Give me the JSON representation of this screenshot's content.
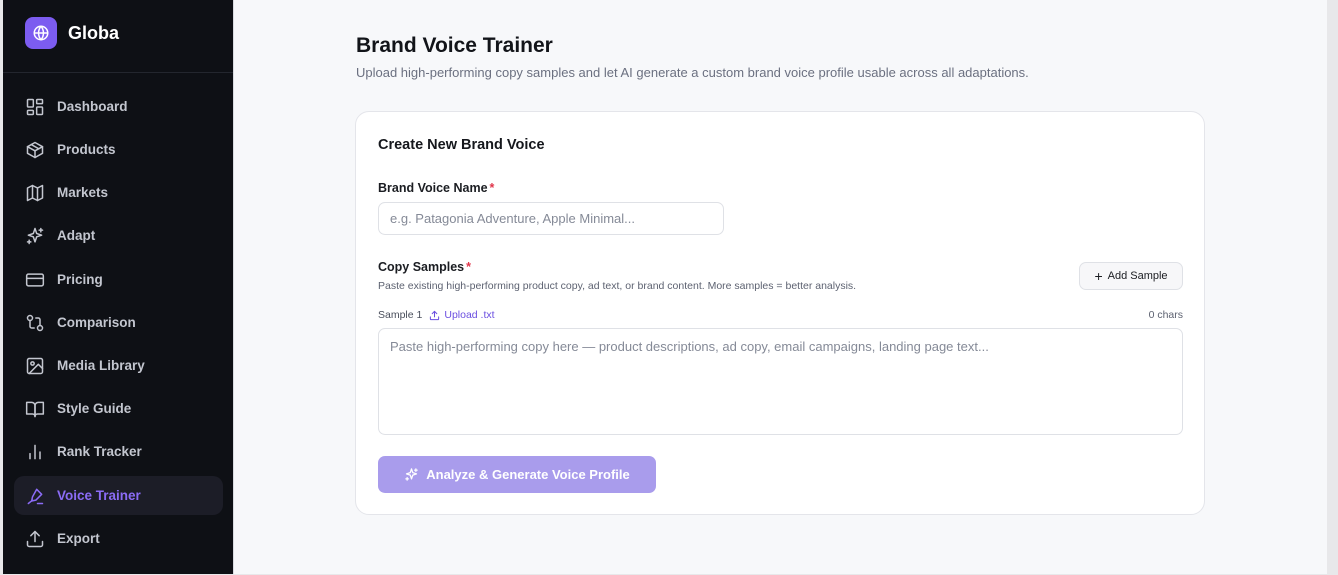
{
  "app": {
    "name": "Globa"
  },
  "sidebar": {
    "items": [
      {
        "label": "Dashboard",
        "icon": "dashboard-icon"
      },
      {
        "label": "Products",
        "icon": "package-icon"
      },
      {
        "label": "Markets",
        "icon": "map-icon"
      },
      {
        "label": "Adapt",
        "icon": "sparkles-icon"
      },
      {
        "label": "Pricing",
        "icon": "credit-card-icon"
      },
      {
        "label": "Comparison",
        "icon": "git-compare-icon"
      },
      {
        "label": "Media Library",
        "icon": "image-icon"
      },
      {
        "label": "Style Guide",
        "icon": "book-icon"
      },
      {
        "label": "Rank Tracker",
        "icon": "bar-chart-icon"
      },
      {
        "label": "Voice Trainer",
        "icon": "pen-icon",
        "active": true
      },
      {
        "label": "Export",
        "icon": "upload-icon"
      }
    ]
  },
  "page": {
    "title": "Brand Voice Trainer",
    "subtitle": "Upload high-performing copy samples and let AI generate a custom brand voice profile usable across all adaptations."
  },
  "form": {
    "card_title": "Create New Brand Voice",
    "name_label": "Brand Voice Name",
    "required_mark": "*",
    "name_value": "",
    "name_placeholder": "e.g. Patagonia Adventure, Apple Minimal...",
    "samples_label": "Copy Samples",
    "samples_hint": "Paste existing high-performing product copy, ad text, or brand content. More samples = better analysis.",
    "add_sample_label": "Add Sample",
    "sample_label": "Sample 1",
    "upload_label": "Upload .txt",
    "char_count": "0 chars",
    "sample_value": "",
    "sample_placeholder": "Paste high-performing copy here — product descriptions, ad copy, email campaigns, landing page text...",
    "analyze_label": "Analyze & Generate Voice Profile"
  },
  "colors": {
    "accent": "#7c5cf0",
    "sidebar_bg": "#0e1015",
    "analyze_button_disabled": "#a99cec",
    "required": "#e0354a"
  }
}
